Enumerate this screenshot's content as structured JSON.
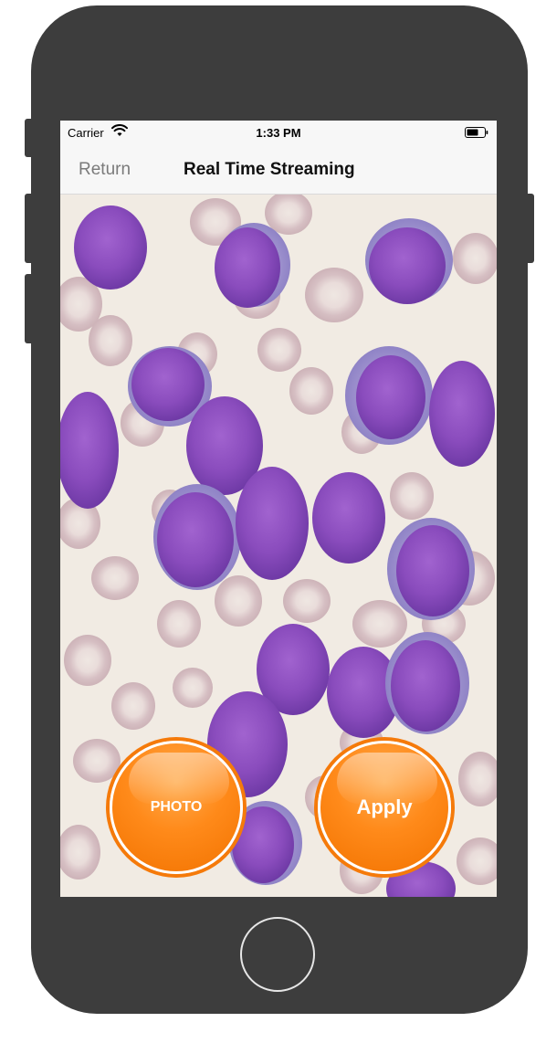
{
  "status_bar": {
    "carrier": "Carrier",
    "time": "1:33 PM",
    "icons": [
      "wifi-icon",
      "battery-icon"
    ]
  },
  "nav_bar": {
    "back_label": "Return",
    "title": "Real Time Streaming"
  },
  "camera": {
    "content": "blood-smear-microscopy"
  },
  "buttons": {
    "photo_label": "PHOTO",
    "apply_label": "Apply"
  },
  "colors": {
    "frame": "#3d3d3d",
    "accent_orange": "#f57a0a",
    "bar_background": "#f7f7f7",
    "cell_purple": "#8e4fc0",
    "red_cell": "#dcc7c9"
  }
}
